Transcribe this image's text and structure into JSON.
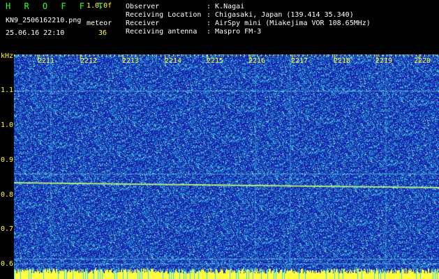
{
  "header": {
    "app_title": "H R O F F T",
    "version": "1.0.0f",
    "filename": "KN9_2506162210.png",
    "timestamp": "25.06.16 22:10",
    "meteor_label": "meteor",
    "meteor_count": "36",
    "info": [
      {
        "label": "Observer",
        "value": ": K.Nagai"
      },
      {
        "label": "Receiving Location",
        "value": ": Chigasaki, Japan (139.414 35.340)"
      },
      {
        "label": "Receiver",
        "value": ": AirSpy mini (Miakejima VOR 108.65MHz)"
      },
      {
        "label": "Receiving antenna",
        "value": ": Maspro FM-3"
      }
    ]
  },
  "spectrogram": {
    "y_unit": "kHz",
    "y_ticks": [
      "1.1",
      "1.0",
      "0.9",
      "0.8",
      "0.7",
      "0.6"
    ],
    "x_ticks": [
      "2211",
      "2212",
      "2213",
      "2214",
      "2215",
      "2216",
      "2217",
      "2218",
      "2219",
      "2220"
    ],
    "colors": {
      "background": "#1a2aa8",
      "noise": "#3ad6e8",
      "signal": "#ffff40",
      "axis": "#ffff33"
    }
  }
}
